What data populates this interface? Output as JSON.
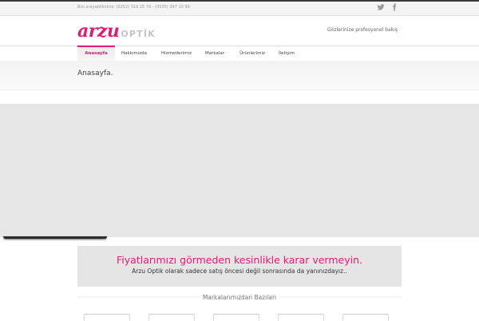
{
  "topbar": {
    "contact": "Bizi arayabilirsiniz: (0252) 319 25 70 - (0535) 397 10 99",
    "social": [
      {
        "icon": "twitter-icon"
      },
      {
        "icon": "facebook-icon"
      }
    ]
  },
  "header": {
    "logo_brand": "arzu",
    "logo_sub": "OPTİK",
    "tagline": "Gözlerinize profesyonel bakış"
  },
  "nav": {
    "items": [
      {
        "label": "Anasayfa",
        "active": true
      },
      {
        "label": "Hakkımızda",
        "active": false
      },
      {
        "label": "Hizmetlerimiz",
        "active": false
      },
      {
        "label": "Markalar",
        "active": false
      },
      {
        "label": "Ürünlerimiz",
        "active": false
      },
      {
        "label": "İletişim",
        "active": false
      }
    ]
  },
  "page": {
    "title": "Anasayfa."
  },
  "promo": {
    "heading": "Fiyatlarımızı görmeden kesinlikle karar vermeyin.",
    "text": "Arzu Optik olarak sadece satış öncesi değil sonrasında da yanınızdayız.."
  },
  "brands": {
    "title": "Markalarımızdan Bazıları"
  },
  "colors": {
    "accent": "#e31c73",
    "topline": "#3a3a3a",
    "slider_bg": "#e7e7e7"
  }
}
